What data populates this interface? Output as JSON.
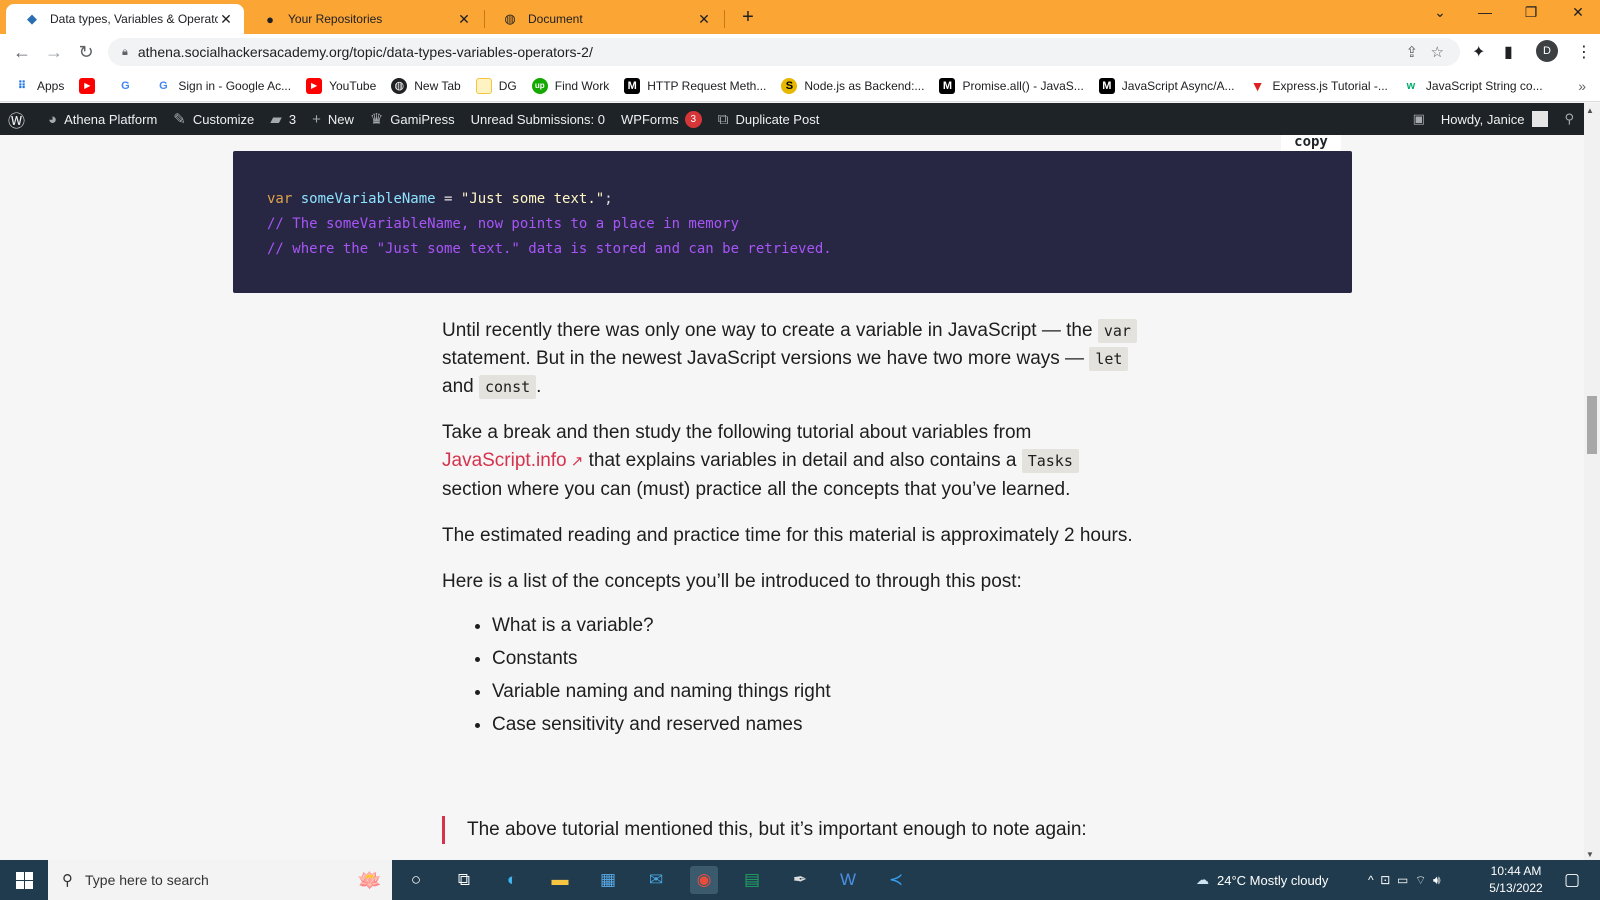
{
  "browser": {
    "tabs": [
      {
        "title": "Data types, Variables & Operator",
        "icon": "athena-icon"
      },
      {
        "title": "Your Repositories",
        "icon": "github-icon"
      },
      {
        "title": "Document",
        "icon": "globe-icon"
      }
    ],
    "url": "athena.socialhackersacademy.org/topic/data-types-variables-operators-2/",
    "profile_initial": "D",
    "bookmarks": [
      {
        "label": "Apps",
        "icon": "apps-grid-icon",
        "color": "#1a73e8"
      },
      {
        "label": "",
        "icon": "youtube-icon",
        "color": "#ff0000"
      },
      {
        "label": "",
        "icon": "google-icon",
        "color": "#4285f4"
      },
      {
        "label": "Sign in - Google Ac...",
        "icon": "google-icon",
        "color": "#4285f4"
      },
      {
        "label": "YouTube",
        "icon": "youtube-icon",
        "color": "#ff0000"
      },
      {
        "label": "New Tab",
        "icon": "globe-icon",
        "color": "#202124"
      },
      {
        "label": "DG",
        "icon": "folder-icon",
        "color": "#f4c542"
      },
      {
        "label": "Find Work",
        "icon": "upwork-icon",
        "color": "#14a800"
      },
      {
        "label": "HTTP Request Meth...",
        "icon": "mdn-icon",
        "color": "#000000"
      },
      {
        "label": "Node.js as Backend:...",
        "icon": "dollar-icon",
        "color": "#e6b800"
      },
      {
        "label": "Promise.all() - JavaS...",
        "icon": "mdn-icon",
        "color": "#000000"
      },
      {
        "label": "JavaScript Async/A...",
        "icon": "mdn-icon",
        "color": "#000000"
      },
      {
        "label": "Express.js Tutorial -...",
        "icon": "triangle-icon",
        "color": "#e02020"
      },
      {
        "label": "JavaScript String co...",
        "icon": "w3-icon",
        "color": "#04aa6d"
      }
    ]
  },
  "adminbar": {
    "site_name": "Athena Platform",
    "customize": "Customize",
    "comments_count": "3",
    "new": "New",
    "gamipress": "GamiPress",
    "unread": "Unread Submissions: 0",
    "wpforms": "WPForms",
    "wpforms_badge": "3",
    "duplicate": "Duplicate Post",
    "howdy": "Howdy, Janice"
  },
  "code": {
    "copy_label": "copy",
    "line1_kw": "var",
    "line1_var": " someVariableName",
    "line1_op": " = ",
    "line1_str": "\"Just some text.\"",
    "line1_end": ";",
    "line2": "// The someVariableName, now points to a place in memory",
    "line3": "// where the \"Just some text.\" data is stored and can be retrieved."
  },
  "article": {
    "p1_a": "Until recently there was only one way to create a variable in JavaScript — the ",
    "p1_code1": "var",
    "p1_b": " statement. But in the newest JavaScript versions we have two more ways — ",
    "p1_code2": "let",
    "p1_c": " and ",
    "p1_code3": "const",
    "p1_d": ".",
    "p2_a": "Take a break and then study the following tutorial about variables from ",
    "p2_link": "JavaScript.info",
    "p2_b": " that explains variables in detail and also contains a ",
    "p2_code": "Tasks",
    "p2_c": " section where you can (must) practice all the concepts that you’ve learned.",
    "p3": "The estimated reading and practice time for this material is approximately 2 hours.",
    "p4": "Here is a list of the concepts you’ll be introduced to through this post:",
    "list": [
      "What is a variable?",
      "Constants",
      "Variable naming and naming things right",
      "Case sensitivity and reserved names"
    ],
    "quote": "The above tutorial mentioned this, but it’s important enough to note again:"
  },
  "taskbar": {
    "search_placeholder": "Type here to search",
    "weather": "24°C  Mostly cloudy",
    "time": "10:44 AM",
    "date": "5/13/2022"
  },
  "colors": {
    "tab_strip": "#fba534",
    "adminbar": "#1d2327",
    "code_bg": "#272643",
    "link": "#d6324d",
    "taskbar": "#1f3b4d"
  }
}
